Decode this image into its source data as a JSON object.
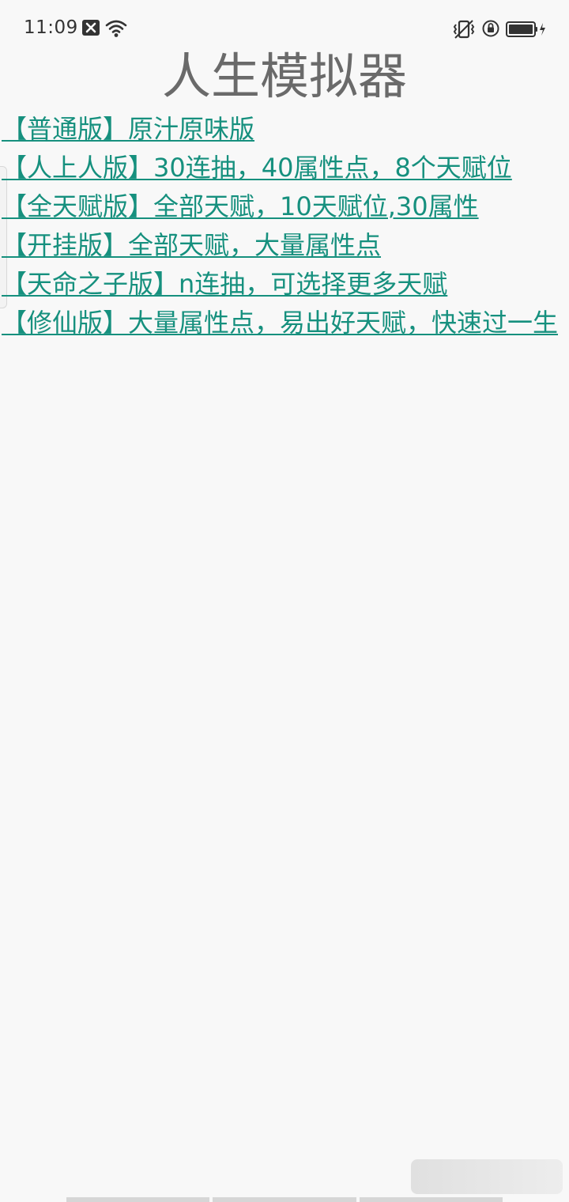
{
  "status_bar": {
    "time": "11:09",
    "icons": [
      "notification-x-icon",
      "wifi-icon",
      "vibrate-icon",
      "rotation-lock-icon",
      "battery-icon"
    ]
  },
  "page": {
    "title": "人生模拟器"
  },
  "versions": [
    {
      "label": "【普通版】原汁原味版"
    },
    {
      "label": "【人上人版】30连抽，40属性点，8个天赋位"
    },
    {
      "label": "【全天赋版】全部天赋，10天赋位,30属性"
    },
    {
      "label": "【开挂版】全部天赋，大量属性点"
    },
    {
      "label": "【天命之子版】n连抽，可选择更多天赋"
    },
    {
      "label": "【修仙版】大量属性点，易出好天赋，快速过一生"
    }
  ],
  "colors": {
    "link": "#16907e",
    "title": "#6a6a6a",
    "background": "#f8f8f8"
  }
}
